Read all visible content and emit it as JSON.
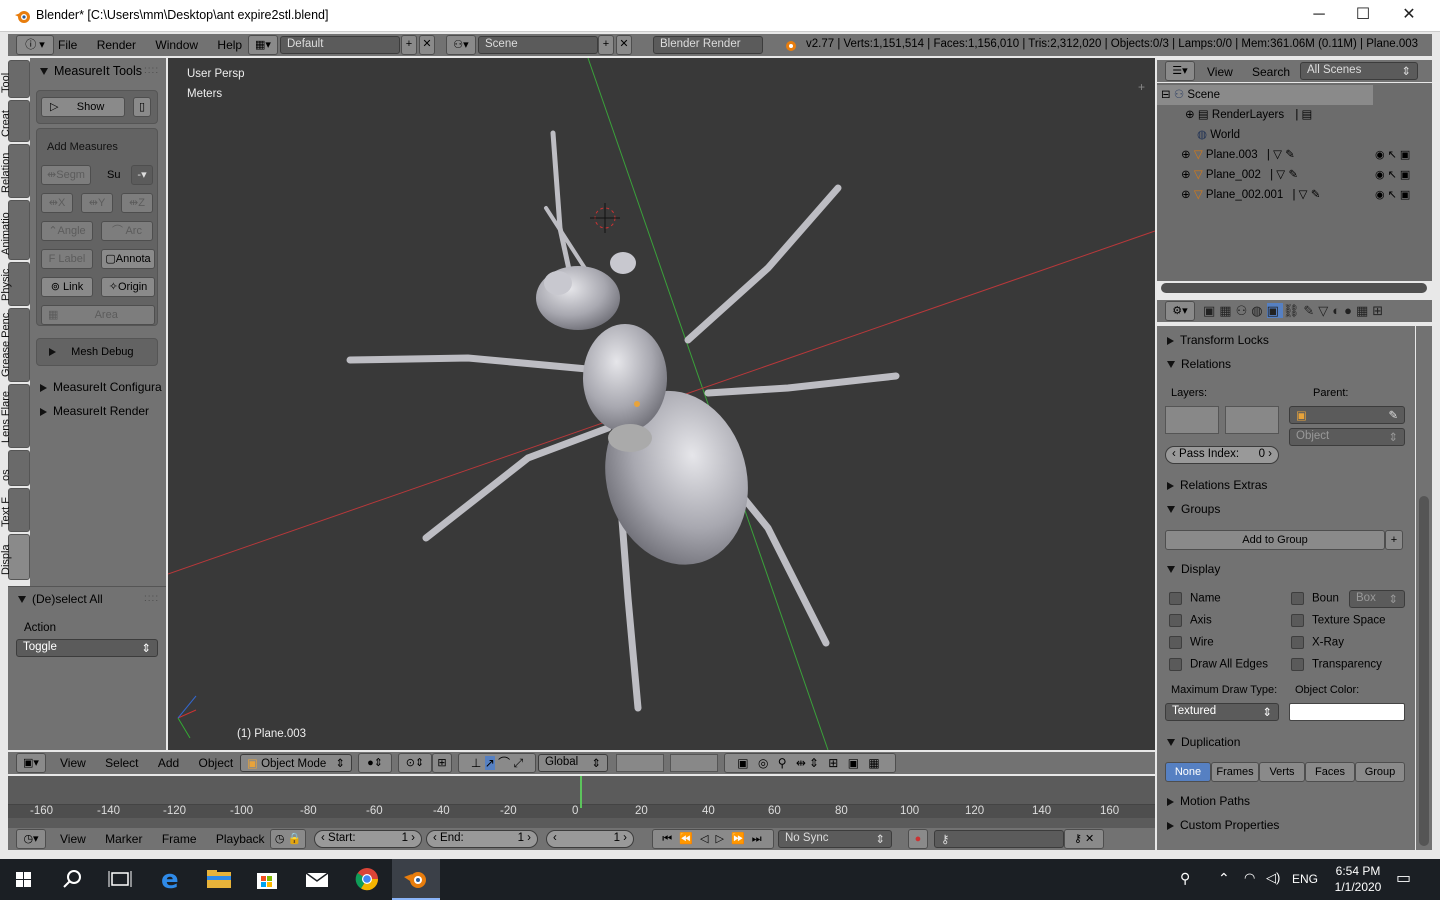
{
  "window": {
    "title": "Blender* [C:\\Users\\mm\\Desktop\\ant expire2stl.blend]",
    "min": "─",
    "max": "☐",
    "close": "✕"
  },
  "topbar": {
    "menus": [
      "File",
      "Render",
      "Window",
      "Help"
    ],
    "layout": "Default",
    "scene": "Scene",
    "engine": "Blender Render",
    "stats": "v2.77 | Verts:1,151,514 | Faces:1,156,010 | Tris:2,312,020 | Objects:0/3 | Lamps:0/0 | Mem:361.06M (0.11M) | Plane.003"
  },
  "left_tabs": [
    "Tool",
    "Creat",
    "Relation",
    "Animatio",
    "Physic",
    "Grease Penc",
    "Lens Flare",
    "os",
    "Text F",
    "Displa"
  ],
  "measureit": {
    "title": "MeasureIt Tools",
    "show": "Show",
    "add_measures": "Add Measures",
    "segm": "Segm",
    "su": "Su",
    "x": "X",
    "y": "Y",
    "z": "Z",
    "angle": "Angle",
    "arc": "Arc",
    "label": "Label",
    "annota": "Annota",
    "link": "Link",
    "origin": "Origin",
    "area": "Area",
    "mesh_debug": "Mesh Debug",
    "configura": "MeasureIt Configura",
    "render": "MeasureIt Render"
  },
  "operator": {
    "title": "(De)select All",
    "action_label": "Action",
    "action_value": "Toggle"
  },
  "viewport": {
    "persp": "User Persp",
    "units": "Meters",
    "object": "(1) Plane.003"
  },
  "outliner": {
    "view": "View",
    "search": "Search",
    "filter": "All Scenes",
    "items": [
      {
        "name": "Scene"
      },
      {
        "name": "RenderLayers"
      },
      {
        "name": "World"
      },
      {
        "name": "Plane.003"
      },
      {
        "name": "Plane_002"
      },
      {
        "name": "Plane_002.001"
      }
    ]
  },
  "properties": {
    "transform_locks": "Transform Locks",
    "relations": "Relations",
    "layers": "Layers:",
    "parent": "Parent:",
    "parent_type": "Object",
    "pass_index_label": "Pass Index:",
    "pass_index": "0",
    "relations_extras": "Relations Extras",
    "groups": "Groups",
    "add_to_group": "Add to Group",
    "display": "Display",
    "name": "Name",
    "boun": "Boun",
    "box": "Box",
    "axis": "Axis",
    "texture_space": "Texture Space",
    "wire": "Wire",
    "xray": "X-Ray",
    "draw_all_edges": "Draw All Edges",
    "transparency": "Transparency",
    "max_draw_type": "Maximum Draw Type:",
    "object_color": "Object Color:",
    "draw_type": "Textured",
    "duplication": "Duplication",
    "dup_options": [
      "None",
      "Frames",
      "Verts",
      "Faces",
      "Group"
    ],
    "motion_paths": "Motion Paths",
    "custom_properties": "Custom Properties"
  },
  "view3d_header": {
    "menus": [
      "View",
      "Select",
      "Add",
      "Object"
    ],
    "mode": "Object Mode",
    "orientation": "Global"
  },
  "timeline": {
    "ticks": [
      "-160",
      "-140",
      "-120",
      "-100",
      "-80",
      "-60",
      "-40",
      "-20",
      "0",
      "20",
      "40",
      "60",
      "80",
      "100",
      "120",
      "140",
      "160"
    ],
    "current_frame_value": 0
  },
  "timeline_header": {
    "menus": [
      "View",
      "Marker",
      "Frame",
      "Playback"
    ],
    "start_label": "Start:",
    "start": "1",
    "end_label": "End:",
    "end": "1",
    "frame": "1",
    "sync": "No Sync"
  },
  "taskbar": {
    "lang": "ENG",
    "time": "6:54 PM",
    "date": "1/1/2020"
  },
  "colors": {
    "viewport": "#393939",
    "panel": "#727272",
    "accent": "#5680c2",
    "x_axis": "#b8383a",
    "y_axis": "#3aa13a"
  }
}
